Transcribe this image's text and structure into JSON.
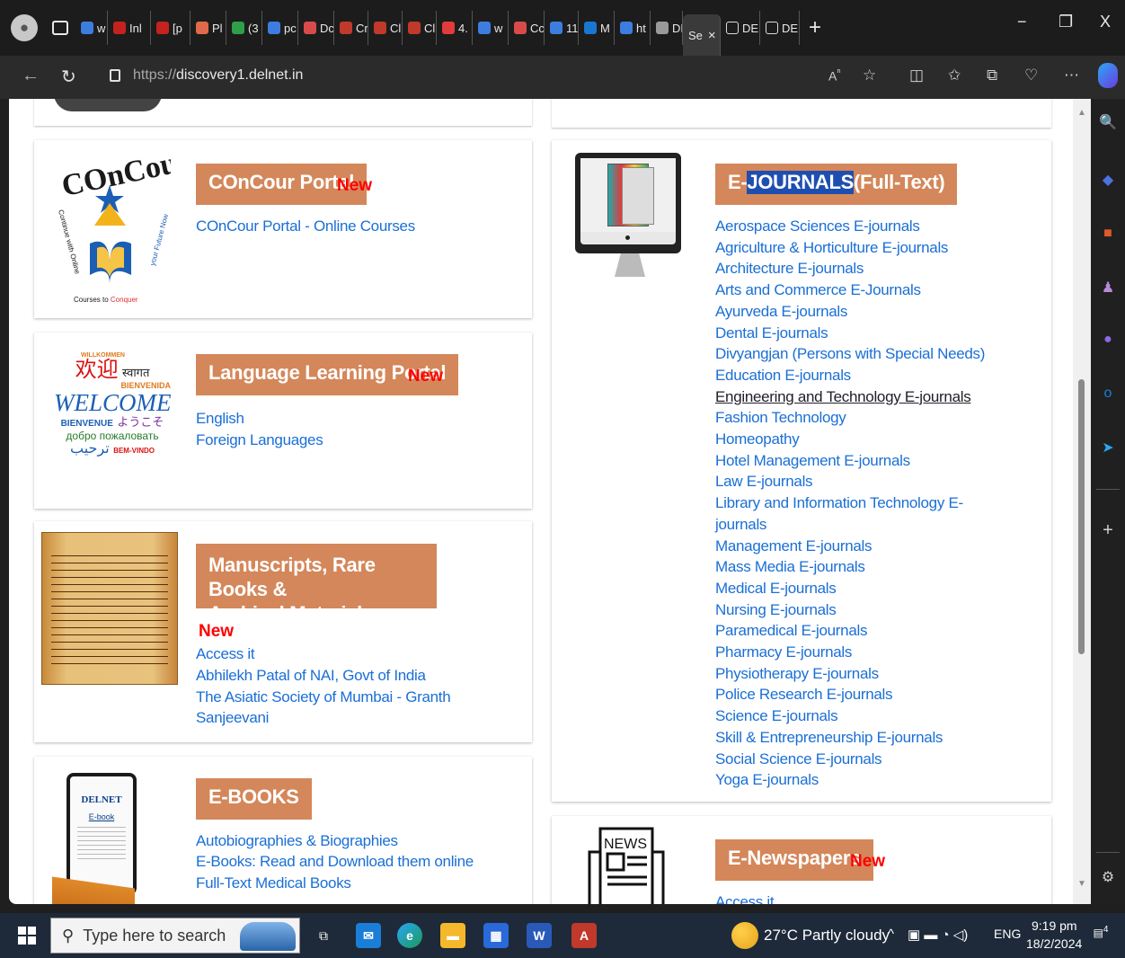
{
  "browser": {
    "tabs": [
      {
        "label": "w",
        "color": "#3d7de0",
        "icon": "search-icon"
      },
      {
        "label": "Inl",
        "color": "#c5221f",
        "icon": "gmail-icon"
      },
      {
        "label": "[p",
        "color": "#c5221f",
        "icon": "gmail-icon"
      },
      {
        "label": "Pl",
        "color": "#e06a4a",
        "icon": "heart-icon"
      },
      {
        "label": "(3",
        "color": "#2e9e4a",
        "icon": "whatsapp-icon"
      },
      {
        "label": "pc",
        "color": "#3d7de0",
        "icon": "search-icon"
      },
      {
        "label": "Dc",
        "color": "#d94b4b",
        "icon": "heart-icon"
      },
      {
        "label": "Cr",
        "color": "#c0392b",
        "icon": "pdf-icon"
      },
      {
        "label": "Cl",
        "color": "#c0392b",
        "icon": "pdf-icon"
      },
      {
        "label": "Cl",
        "color": "#c0392b",
        "icon": "pdf-icon"
      },
      {
        "label": "4.",
        "color": "#e23b3b",
        "icon": "app-icon"
      },
      {
        "label": "w",
        "color": "#3d7de0",
        "icon": "search-icon"
      },
      {
        "label": "Cc",
        "color": "#d94b4b",
        "icon": "heart-icon"
      },
      {
        "label": "11",
        "color": "#3d7de0",
        "icon": "search-icon"
      },
      {
        "label": "M",
        "color": "#1976d2",
        "icon": "app-icon"
      },
      {
        "label": "ht",
        "color": "#3d7de0",
        "icon": "search-icon"
      },
      {
        "label": "DE",
        "color": "#9a9a9a",
        "icon": "page-icon"
      }
    ],
    "active_tab_label": "Se",
    "after_tabs": [
      {
        "label": "DE",
        "icon": "page-icon"
      },
      {
        "label": "DE",
        "icon": "page-icon"
      }
    ],
    "url_proto": "https://",
    "url_host": "discovery1.delnet.in"
  },
  "concour": {
    "heading": "COnCour Portal",
    "new": "New",
    "logo_text": "COnCour",
    "logo_tagline": "Continue with Online Courses to Conquer your Future Now",
    "links": [
      "COnCour Portal - Online Courses"
    ]
  },
  "language": {
    "heading": "Language Learning Portal",
    "new": "New",
    "logo_words": [
      "WILLKOMMEN",
      "स्वागत",
      "欢迎",
      "BIENVENIDA",
      "WELCOME",
      "BIENVENUE",
      "ようこそ",
      "добро пожаловать",
      "ترحيب",
      "BEM-VINDO"
    ],
    "links": [
      "English",
      "Foreign Languages"
    ]
  },
  "manuscripts": {
    "heading_line1": "Manuscripts, Rare Books &",
    "heading_line2": "Archival Materials",
    "new": "New",
    "links": [
      "Access it",
      "Abhilekh Patal of NAI, Govt of India",
      "The Asiatic Society of Mumbai - Granth",
      "Sanjeevani"
    ]
  },
  "ebooks": {
    "heading": "E-BOOKS",
    "logo_brand": "DELNET",
    "logo_label": "E-book",
    "links": [
      "Autobiographies & Biographies",
      "E-Books: Read and Download them online",
      "Full-Text Medical Books"
    ]
  },
  "ejournals": {
    "heading_prefix": "E-",
    "heading_highlight": "JOURNALS",
    "heading_suffix": " (Full-Text)",
    "links": [
      "Aerospace Sciences E-journals",
      "Agriculture & Horticulture E-journals",
      "Architecture E-journals",
      "Arts and Commerce E-Journals",
      "Ayurveda E-journals",
      "Dental E-journals",
      "Divyangjan (Persons with Special Needs)",
      "Education E-journals",
      "Engineering and Technology E-journals",
      "Fashion Technology",
      "Homeopathy",
      "Hotel Management E-journals",
      "Law E-journals",
      "Library and Information Technology E-",
      "journals",
      "Management E-journals",
      "Mass Media E-journals",
      "Medical E-journals",
      "Nursing E-journals",
      "Paramedical E-journals",
      "Pharmacy E-journals",
      "Physiotherapy E-journals",
      "Police Research E-journals",
      "Science E-journals",
      "Skill & Entrepreneurship E-journals",
      "Social Science E-journals",
      "Yoga E-journals"
    ]
  },
  "newspapers": {
    "heading": "E-Newspapers",
    "new": "New",
    "logo_label": "NEWS",
    "links": [
      "Access it"
    ]
  },
  "taskbar": {
    "search_placeholder": "Type here to search",
    "weather": "27°C  Partly cloudy",
    "lang": "ENG",
    "time": "9:19 pm",
    "date": "18/2/2024",
    "notif": "4"
  },
  "colors": {
    "accent": "#d4875a",
    "link": "#1a6fd6",
    "new": "#ff0000"
  }
}
